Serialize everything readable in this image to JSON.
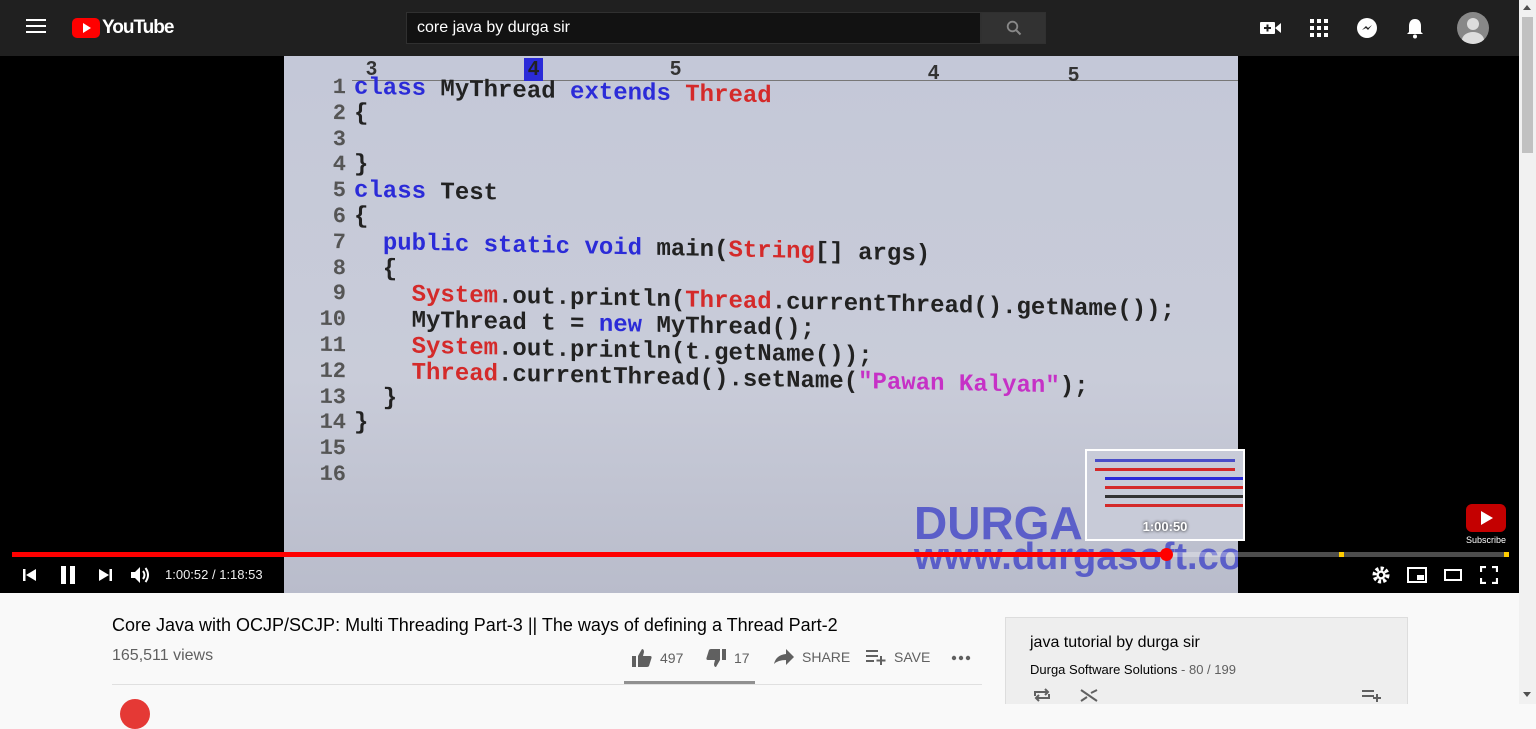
{
  "masthead": {
    "logo_text": "YouTube",
    "search_value": "core java by durga sir"
  },
  "video": {
    "ruler_marks": [
      "3",
      "4",
      "5",
      "4",
      "5"
    ],
    "code_lines": [
      {
        "n": "1",
        "parts": [
          [
            "kw",
            "class "
          ],
          [
            "",
            "MyThread "
          ],
          [
            "kw",
            "extends "
          ],
          [
            "cls",
            "Thread"
          ]
        ]
      },
      {
        "n": "2",
        "parts": [
          [
            "",
            "{"
          ]
        ]
      },
      {
        "n": "3",
        "parts": [
          [
            "",
            ""
          ]
        ]
      },
      {
        "n": "4",
        "parts": [
          [
            "",
            "}"
          ]
        ]
      },
      {
        "n": "5",
        "parts": [
          [
            "kw",
            "class "
          ],
          [
            "",
            "Test"
          ]
        ]
      },
      {
        "n": "6",
        "parts": [
          [
            "",
            "{"
          ]
        ]
      },
      {
        "n": "7",
        "parts": [
          [
            "",
            "  "
          ],
          [
            "kw",
            "public static void "
          ],
          [
            "",
            "main("
          ],
          [
            "cls",
            "String"
          ],
          [
            "",
            "[] args)"
          ]
        ]
      },
      {
        "n": "8",
        "parts": [
          [
            "",
            "  {"
          ]
        ]
      },
      {
        "n": "9",
        "parts": [
          [
            "",
            "    "
          ],
          [
            "cls",
            "System"
          ],
          [
            "",
            ".out.println("
          ],
          [
            "cls",
            "Thread"
          ],
          [
            "",
            ".currentThread().getName());"
          ]
        ]
      },
      {
        "n": "10",
        "parts": [
          [
            "",
            "    MyThread t = "
          ],
          [
            "kw",
            "new "
          ],
          [
            "",
            "MyThread();"
          ]
        ]
      },
      {
        "n": "11",
        "parts": [
          [
            "",
            "    "
          ],
          [
            "cls",
            "System"
          ],
          [
            "",
            ".out.println(t.getName());"
          ]
        ]
      },
      {
        "n": "12",
        "parts": [
          [
            "",
            "    "
          ],
          [
            "cls",
            "Thread"
          ],
          [
            "",
            ".currentThread().setName("
          ],
          [
            "str",
            "\"Pawan Kalyan\""
          ],
          [
            "",
            ");"
          ]
        ]
      },
      {
        "n": "13",
        "parts": [
          [
            "",
            "  }"
          ]
        ]
      },
      {
        "n": "14",
        "parts": [
          [
            "",
            "}"
          ]
        ]
      },
      {
        "n": "15",
        "parts": [
          [
            "",
            ""
          ]
        ]
      },
      {
        "n": "16",
        "parts": [
          [
            "",
            ""
          ]
        ]
      }
    ],
    "watermark_brand": "DURGA",
    "watermark_url": "www.durgasoft.com",
    "preview_time": "1:00:50",
    "subscribe_label": "Subscribe",
    "time_display": "1:00:52 / 1:18:53",
    "progress_fraction": 0.772,
    "marker_fractions": [
      0.889,
      0.999
    ]
  },
  "info": {
    "title": "Core Java with OCJP/SCJP: Multi Threading Part-3 || The ways of defining a Thread Part-2",
    "views": "165,511 views",
    "likes": "497",
    "dislikes": "17",
    "share_label": "SHARE",
    "save_label": "SAVE"
  },
  "playlist": {
    "title": "java tutorial by durga sir",
    "channel": "Durga Software Solutions",
    "position": "- 80 / 199"
  },
  "colors": {
    "accent": "#ff0000",
    "masthead_bg": "#202020",
    "keyword": "#2b2bd8",
    "class_name": "#d42a2a",
    "string": "#c631c6"
  }
}
